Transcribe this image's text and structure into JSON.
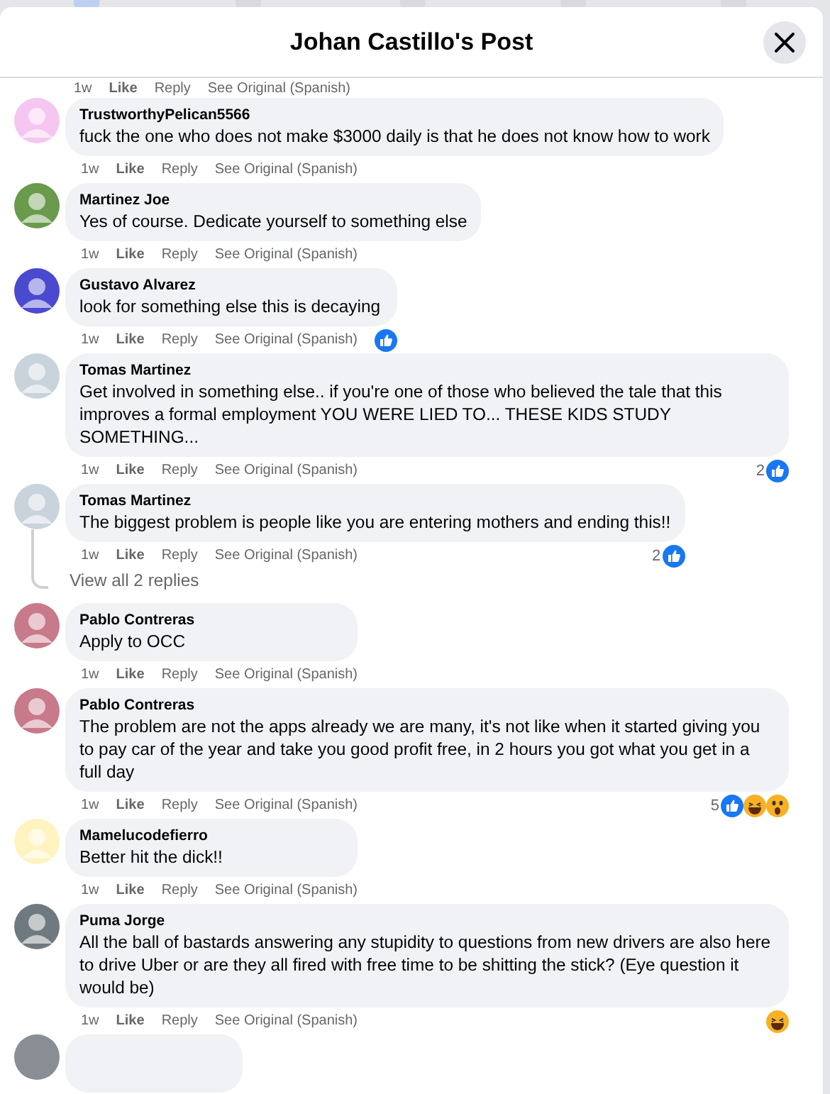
{
  "dialog": {
    "title": "Johan Castillo's Post"
  },
  "top_actions": {
    "time": "1w",
    "like": "Like",
    "reply": "Reply",
    "translate": "See Original (Spanish)"
  },
  "comments": [
    {
      "author": "TrustworthyPelican5566",
      "text": "fuck the one who does not make $3000 daily is that he does not know how to work",
      "time": "1w",
      "like": "Like",
      "reply": "Reply",
      "translate": "See Original (Spanish)"
    },
    {
      "author": "Martinez Joe",
      "text": "Yes of course. Dedicate yourself to something else",
      "time": "1w",
      "like": "Like",
      "reply": "Reply",
      "translate": "See Original (Spanish)"
    },
    {
      "author": "Gustavo Alvarez",
      "text": "look for something else this is decaying",
      "time": "1w",
      "like": "Like",
      "reply": "Reply",
      "translate": "See Original (Spanish)",
      "reactions": [
        {
          "kind": "like"
        }
      ]
    },
    {
      "author": "Tomas Martinez",
      "text": "Get involved in something else.. if you're one of those who believed the tale that this improves a formal employment YOU WERE LIED TO... THESE KIDS STUDY SOMETHING...",
      "time": "1w",
      "like": "Like",
      "reply": "Reply",
      "translate": "See Original (Spanish)",
      "reaction_count": "2",
      "reactions": [
        {
          "kind": "like"
        }
      ]
    },
    {
      "author": "Tomas Martinez",
      "text": "The biggest problem is people like you are entering mothers and ending this!!",
      "time": "1w",
      "like": "Like",
      "reply": "Reply",
      "translate": "See Original (Spanish)",
      "reaction_count": "2",
      "reactions": [
        {
          "kind": "like"
        }
      ],
      "view_replies": "View all 2 replies"
    },
    {
      "author": "Pablo Contreras",
      "text": "Apply to OCC",
      "time": "1w",
      "like": "Like",
      "reply": "Reply",
      "translate": "See Original (Spanish)"
    },
    {
      "author": "Pablo Contreras",
      "text": "The problem are not the apps already we are many, it's not like when it started giving you to pay car of the year and take you good profit free, in 2 hours you got what you get in a full day",
      "time": "1w",
      "like": "Like",
      "reply": "Reply",
      "translate": "See Original (Spanish)",
      "reaction_count": "5",
      "reactions": [
        {
          "kind": "like"
        },
        {
          "kind": "haha"
        },
        {
          "kind": "wow"
        }
      ]
    },
    {
      "author": "Mamelucodefierro",
      "text": "Better hit the dick!!",
      "time": "1w",
      "like": "Like",
      "reply": "Reply",
      "translate": "See Original (Spanish)"
    },
    {
      "author": "Puma Jorge",
      "text": "All the ball of bastards answering any stupidity to questions from new drivers are also here to drive Uber or are they all fired with free time to be shitting the stick? (Eye question it would be)",
      "time": "1w",
      "like": "Like",
      "reply": "Reply",
      "translate": "See Original (Spanish)",
      "reactions": [
        {
          "kind": "haha"
        }
      ]
    }
  ]
}
